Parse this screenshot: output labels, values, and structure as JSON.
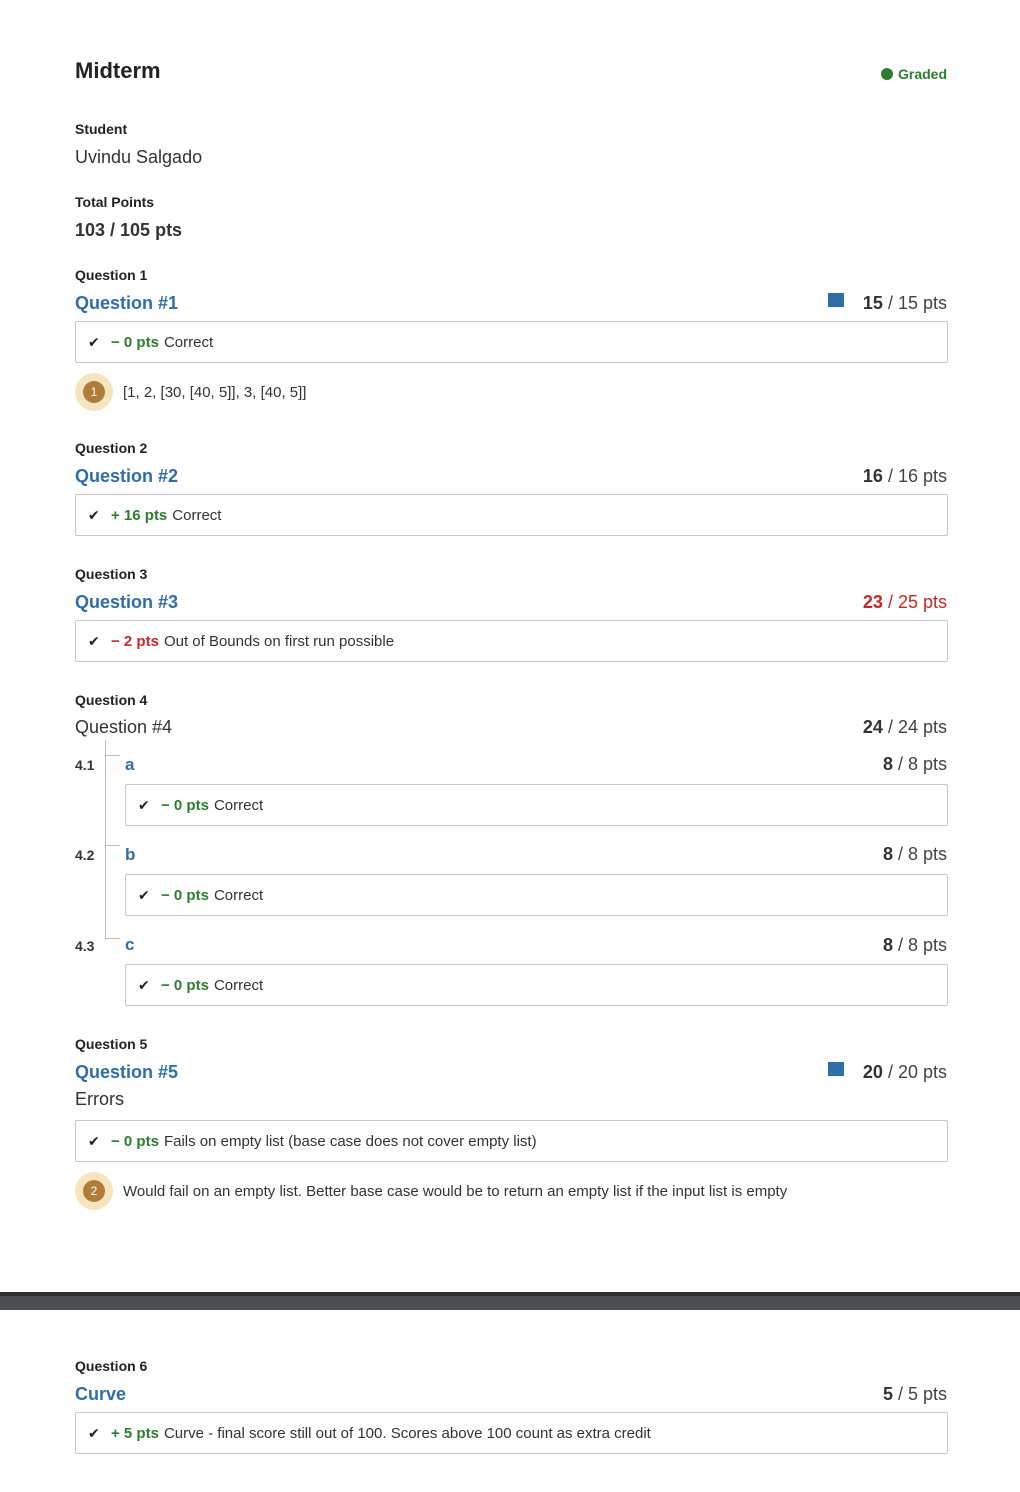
{
  "header": {
    "title": "Midterm",
    "status": "Graded"
  },
  "student": {
    "label": "Student",
    "name": "Uvindu Salgado"
  },
  "total": {
    "label": "Total Points",
    "value": "103 / 105 pts"
  },
  "q1": {
    "label": "Question 1",
    "title": "Question #1",
    "earned": "15",
    "possible": " / 15 pts",
    "rubric_pts": "− 0 pts",
    "rubric_text": "Correct",
    "comment_num": "1",
    "comment": "[1, 2, [30, [40, 5]], 3, [40, 5]]"
  },
  "q2": {
    "label": "Question 2",
    "title": "Question #2",
    "earned": "16",
    "possible": " / 16 pts",
    "rubric_pts": "+ 16 pts",
    "rubric_text": "Correct"
  },
  "q3": {
    "label": "Question 3",
    "title": "Question #3",
    "earned": "23",
    "possible": " / 25 pts",
    "rubric_pts": "− 2 pts",
    "rubric_text": "Out of Bounds on first run possible"
  },
  "q4": {
    "label": "Question 4",
    "title": "Question #4",
    "earned": "24",
    "possible": " / 24 pts",
    "parts": [
      {
        "num": "4.1",
        "title": "a",
        "earned": "8",
        "possible": " / 8 pts",
        "rubric_pts": "− 0 pts",
        "rubric_text": "Correct"
      },
      {
        "num": "4.2",
        "title": "b",
        "earned": "8",
        "possible": " / 8 pts",
        "rubric_pts": "− 0 pts",
        "rubric_text": "Correct"
      },
      {
        "num": "4.3",
        "title": "c",
        "earned": "8",
        "possible": " / 8 pts",
        "rubric_pts": "− 0 pts",
        "rubric_text": "Correct"
      }
    ]
  },
  "q5": {
    "label": "Question 5",
    "title": "Question #5",
    "earned": "20",
    "possible": " / 20 pts",
    "subtext": "Errors",
    "rubric_pts": "− 0 pts",
    "rubric_text": "Fails on empty list (base case does not cover empty list)",
    "comment_num": "2",
    "comment": "Would fail on an empty list. Better base case would be to return an empty list if the input list is empty"
  },
  "q6": {
    "label": "Question 6",
    "title": "Curve",
    "earned": "5",
    "possible": " / 5 pts",
    "rubric_pts": "+ 5 pts",
    "rubric_text": "Curve - final score still out of 100. Scores above 100 count as extra credit"
  },
  "colors": {
    "link_blue": "#2f6ea8",
    "green": "#2e7d32",
    "red": "#c62828",
    "badge": "#b07c3a"
  }
}
